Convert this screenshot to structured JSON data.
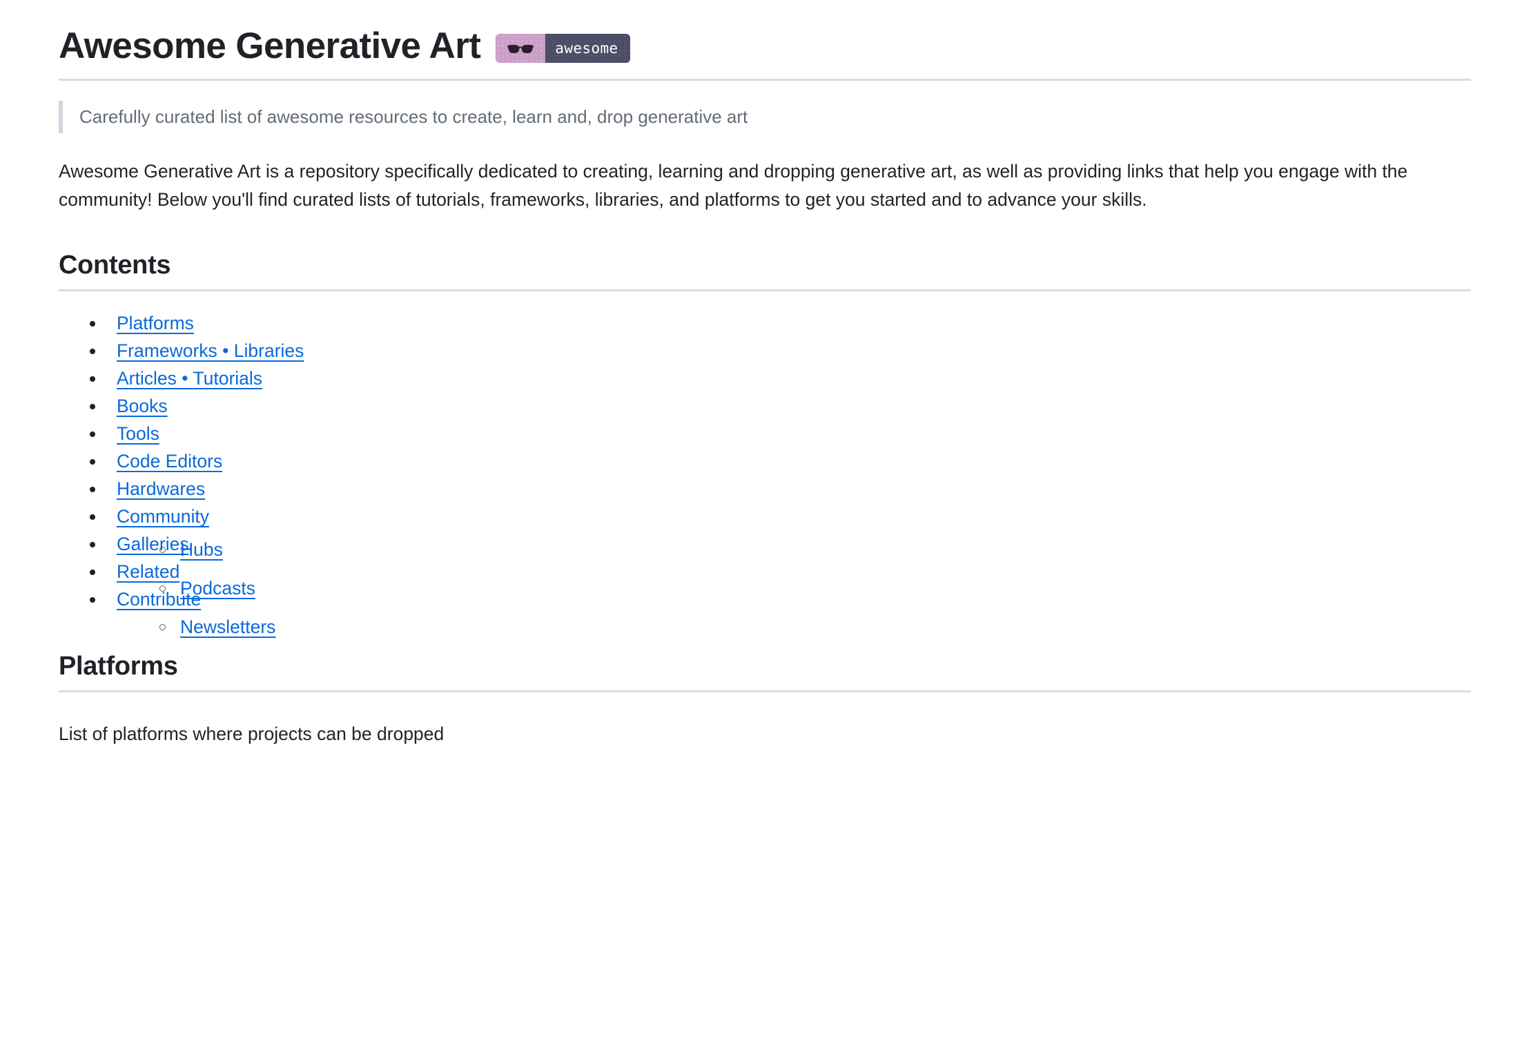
{
  "header": {
    "title": "Awesome Generative Art",
    "badge": {
      "icon": "sunglasses-icon",
      "label": "awesome",
      "left_color": "#cb9fc8",
      "right_color": "#4d4d66",
      "text_color": "#ffffff"
    }
  },
  "blockquote": "Carefully curated list of awesome resources to create, learn and, drop generative art",
  "intro_paragraph": "Awesome Generative Art is a repository specifically dedicated to creating, learning and dropping generative art, as well as providing links that help you engage with the community! Below you'll find curated lists of tutorials, frameworks, libraries, and platforms to get you started and to advance your skills.",
  "contents": {
    "heading": "Contents",
    "items": [
      {
        "label": "Platforms"
      },
      {
        "label": "Frameworks • Libraries"
      },
      {
        "label": "Articles • Tutorials"
      },
      {
        "label": "Books"
      },
      {
        "label": "Tools"
      },
      {
        "label": "Code Editors"
      },
      {
        "label": "Hardwares"
      },
      {
        "label": "Community",
        "children": [
          {
            "label": "Hubs"
          },
          {
            "label": "Podcasts"
          },
          {
            "label": "Newsletters"
          }
        ]
      },
      {
        "label": "Galleries"
      },
      {
        "label": "Related"
      },
      {
        "label": "Contribute"
      }
    ]
  },
  "platforms": {
    "heading": "Platforms",
    "description": "List of platforms where projects can be dropped"
  },
  "colors": {
    "link": "#0969da",
    "text": "#1f2328",
    "muted": "#636c76",
    "rule": "#d8dee4",
    "quote_border": "#d0d7de"
  }
}
